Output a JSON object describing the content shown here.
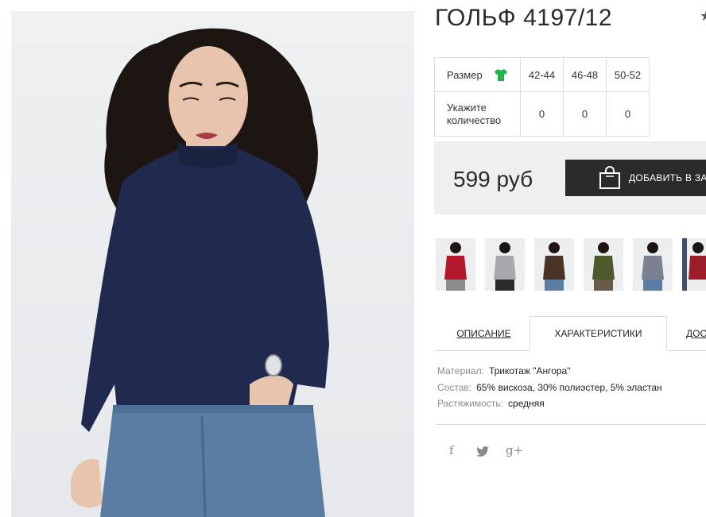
{
  "product": {
    "title": "ГОЛЬФ 4197/12",
    "colors": {
      "garment": "#1f2a4e",
      "skin": "#e9c4ad",
      "hair": "#1c1512",
      "jeans": "#5b7ca3"
    }
  },
  "sizes": {
    "header_label": "Размер",
    "size_icon": "tshirt-icon",
    "sizes": [
      "42-44",
      "46-48",
      "50-52"
    ],
    "quantity_label_line1": "Укажите",
    "quantity_label_line2": "количество",
    "quantities": [
      "0",
      "0",
      "0"
    ]
  },
  "price": {
    "value": "599 руб",
    "add_to_cart_label": "ДОБАВИТЬ В ЗАКАЗ",
    "bag_icon": "shopping-bag-icon"
  },
  "thumbnails": {
    "items": [
      {
        "color": "#b3182b"
      },
      {
        "color": "#a9a9ad"
      },
      {
        "color": "#4a3226"
      },
      {
        "color": "#4c5a2c"
      },
      {
        "color": "#7b8190"
      },
      {
        "color": "#9c1d2a"
      }
    ]
  },
  "tabs": {
    "description": "ОПИСАНИЕ",
    "characteristics": "ХАРАКТЕРИСТИКИ",
    "delivery": "ДОСТАВКА"
  },
  "specs": {
    "material_label": "Материал:",
    "material_value": "Трикотаж \"Ангора\"",
    "composition_label": "Состав:",
    "composition_value": "65% вискоза, 30% полиэстер, 5% эластан",
    "stretch_label": "Растяжимость:",
    "stretch_value": "средняя"
  },
  "social": {
    "facebook": "f",
    "twitter_icon": "twitter-icon",
    "google_plus": "g+"
  }
}
